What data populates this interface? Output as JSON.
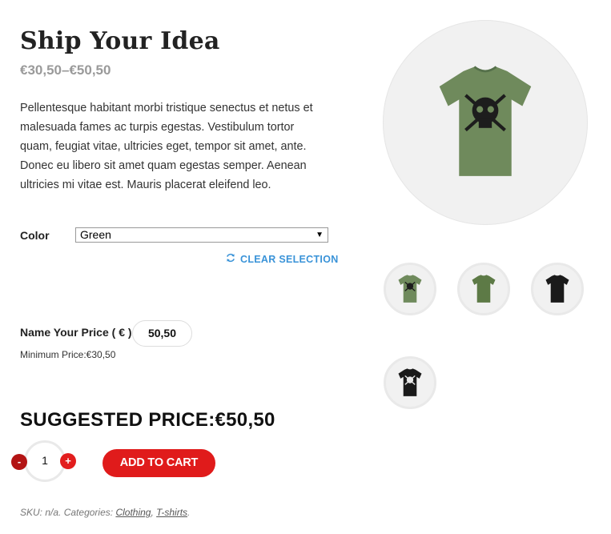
{
  "product": {
    "title": "Ship Your Idea",
    "price_range": "€30,50–€50,50",
    "description": "Pellentesque habitant morbi tristique senectus et netus et malesuada fames ac turpis egestas. Vestibulum tortor quam, feugiat vitae, ultricies eget, tempor sit amet, ante. Donec eu libero sit amet quam egestas semper. Aenean ultricies mi vitae est. Mauris placerat eleifend leo."
  },
  "variation": {
    "color_label": "Color",
    "color_selected": "Green",
    "clear_selection": "CLEAR SELECTION"
  },
  "name_your_price": {
    "label": "Name Your Price ( € )",
    "value": "50,50",
    "minimum": "Minimum Price:€30,50"
  },
  "suggested_price": "SUGGESTED PRICE:€50,50",
  "cart": {
    "quantity": "1",
    "minus": "-",
    "plus": "+",
    "add_to_cart": "ADD TO CART"
  },
  "meta": {
    "sku_label": "SKU:",
    "sku_value": "n/a.",
    "categories_label": "Categories:",
    "categories": [
      "Clothing",
      "T-shirts"
    ]
  },
  "gallery": {
    "main": {
      "shirt_color": "#6f8a5c",
      "graphic": "skull"
    },
    "thumbnails": [
      {
        "shirt_color": "#6f8a5c",
        "graphic": "skull"
      },
      {
        "shirt_color": "#5d7a46",
        "graphic": "none"
      },
      {
        "shirt_color": "#1a1a1a",
        "graphic": "none"
      },
      {
        "shirt_color": "#1a1a1a",
        "graphic": "skull"
      }
    ]
  },
  "colors": {
    "accent_red": "#e01b1b",
    "link_blue": "#3a93d8",
    "muted_price": "#9a9a9a"
  }
}
